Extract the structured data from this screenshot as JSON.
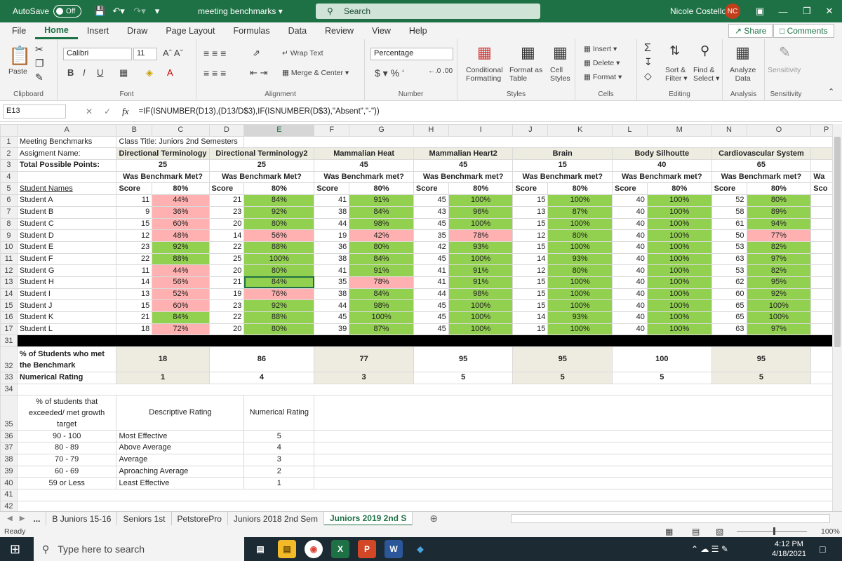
{
  "titlebar": {
    "autosave": "AutoSave",
    "toggle": "Off",
    "filename": "meeting benchmarks",
    "search": "Search",
    "user": "Nicole Costello",
    "initials": "NC"
  },
  "menu": [
    "File",
    "Home",
    "Insert",
    "Draw",
    "Page Layout",
    "Formulas",
    "Data",
    "Review",
    "View",
    "Help"
  ],
  "share": "Share",
  "comments": "Comments",
  "ribbon": {
    "paste": "Paste",
    "clipboard": "Clipboard",
    "font_name": "Calibri",
    "font_size": "11",
    "font": "Font",
    "wrap": "Wrap Text",
    "merge": "Merge & Center",
    "alignment": "Alignment",
    "numfmt": "Percentage",
    "number": "Number",
    "cond": "Conditional",
    "cond2": "Formatting",
    "fmt_table": "Format as",
    "fmt_table2": "Table",
    "cell_styles": "Cell",
    "cell_styles2": "Styles",
    "styles": "Styles",
    "insert": "Insert",
    "delete": "Delete",
    "format": "Format",
    "cells": "Cells",
    "sort": "Sort &",
    "sort2": "Filter",
    "find": "Find &",
    "find2": "Select",
    "editing": "Editing",
    "analyze": "Analyze",
    "analyze2": "Data",
    "analysis": "Analysis",
    "sens": "Sensitivity",
    "sensitivity": "Sensitivity"
  },
  "formula": {
    "cell": "E13",
    "fx": "fx",
    "text": "=IF(ISNUMBER(D13),(D13/D$3),IF(ISNUMBER(D$3),\"Absent\",\"-\"))"
  },
  "cols": [
    "A",
    "B",
    "C",
    "D",
    "E",
    "F",
    "G",
    "H",
    "I",
    "J",
    "K",
    "L",
    "M",
    "N",
    "O",
    "P"
  ],
  "rownums": [
    "1",
    "2",
    "3",
    "4",
    "5",
    "6",
    "7",
    "8",
    "9",
    "10",
    "11",
    "12",
    "13",
    "14",
    "15",
    "16",
    "17",
    "31",
    "32",
    "33",
    "34",
    "35",
    "36",
    "37",
    "38",
    "39",
    "40",
    "41",
    "42"
  ],
  "sheet": {
    "a1": "Meeting Benchmarks",
    "b1": "Class Title: Juniors 2nd Semesters",
    "a2": "Assigment Name:",
    "a3": "Total Possible Points:",
    "a5": "Student Names",
    "assignments": [
      "Directional Terminology",
      "Directional Terminology2",
      "Mammalian Heat",
      "Mammalian Heart2",
      "Brain",
      "Body Silhoutte",
      "Cardiovascular System"
    ],
    "points": [
      "25",
      "25",
      "45",
      "45",
      "15",
      "40",
      "65"
    ],
    "met": [
      "Was Benchmark Met?",
      "Was Benchmark Met?",
      "Was Benchmark met?",
      "Was Benchmark met?",
      "Was Benchmark met?",
      "Was Benchmark met?",
      "Was Benchmark met?"
    ],
    "p_partial": "Wa",
    "p_score": "Sco",
    "score": "Score",
    "pct80": "80%",
    "students": [
      {
        "name": "Student A",
        "v": [
          [
            "11",
            "44%"
          ],
          [
            "21",
            "84%"
          ],
          [
            "41",
            "91%"
          ],
          [
            "45",
            "100%"
          ],
          [
            "15",
            "100%"
          ],
          [
            "40",
            "100%"
          ],
          [
            "52",
            "80%"
          ]
        ]
      },
      {
        "name": "Student B",
        "v": [
          [
            "9",
            "36%"
          ],
          [
            "23",
            "92%"
          ],
          [
            "38",
            "84%"
          ],
          [
            "43",
            "96%"
          ],
          [
            "13",
            "87%"
          ],
          [
            "40",
            "100%"
          ],
          [
            "58",
            "89%"
          ]
        ]
      },
      {
        "name": "Student C",
        "v": [
          [
            "15",
            "60%"
          ],
          [
            "20",
            "80%"
          ],
          [
            "44",
            "98%"
          ],
          [
            "45",
            "100%"
          ],
          [
            "15",
            "100%"
          ],
          [
            "40",
            "100%"
          ],
          [
            "61",
            "94%"
          ]
        ]
      },
      {
        "name": "Student D",
        "v": [
          [
            "12",
            "48%"
          ],
          [
            "14",
            "56%"
          ],
          [
            "19",
            "42%"
          ],
          [
            "35",
            "78%"
          ],
          [
            "12",
            "80%"
          ],
          [
            "40",
            "100%"
          ],
          [
            "50",
            "77%"
          ]
        ]
      },
      {
        "name": "Student E",
        "v": [
          [
            "23",
            "92%"
          ],
          [
            "22",
            "88%"
          ],
          [
            "36",
            "80%"
          ],
          [
            "42",
            "93%"
          ],
          [
            "15",
            "100%"
          ],
          [
            "40",
            "100%"
          ],
          [
            "53",
            "82%"
          ]
        ]
      },
      {
        "name": "Student F",
        "v": [
          [
            "22",
            "88%"
          ],
          [
            "25",
            "100%"
          ],
          [
            "38",
            "84%"
          ],
          [
            "45",
            "100%"
          ],
          [
            "14",
            "93%"
          ],
          [
            "40",
            "100%"
          ],
          [
            "63",
            "97%"
          ]
        ]
      },
      {
        "name": "Student G",
        "v": [
          [
            "11",
            "44%"
          ],
          [
            "20",
            "80%"
          ],
          [
            "41",
            "91%"
          ],
          [
            "41",
            "91%"
          ],
          [
            "12",
            "80%"
          ],
          [
            "40",
            "100%"
          ],
          [
            "53",
            "82%"
          ]
        ]
      },
      {
        "name": "Student H",
        "v": [
          [
            "14",
            "56%"
          ],
          [
            "21",
            "84%"
          ],
          [
            "35",
            "78%"
          ],
          [
            "41",
            "91%"
          ],
          [
            "15",
            "100%"
          ],
          [
            "40",
            "100%"
          ],
          [
            "62",
            "95%"
          ]
        ]
      },
      {
        "name": "Student I",
        "v": [
          [
            "13",
            "52%"
          ],
          [
            "19",
            "76%"
          ],
          [
            "38",
            "84%"
          ],
          [
            "44",
            "98%"
          ],
          [
            "15",
            "100%"
          ],
          [
            "40",
            "100%"
          ],
          [
            "60",
            "92%"
          ]
        ]
      },
      {
        "name": "Student J",
        "v": [
          [
            "15",
            "60%"
          ],
          [
            "23",
            "92%"
          ],
          [
            "44",
            "98%"
          ],
          [
            "45",
            "100%"
          ],
          [
            "15",
            "100%"
          ],
          [
            "40",
            "100%"
          ],
          [
            "65",
            "100%"
          ]
        ]
      },
      {
        "name": "Student K",
        "v": [
          [
            "21",
            "84%"
          ],
          [
            "22",
            "88%"
          ],
          [
            "45",
            "100%"
          ],
          [
            "45",
            "100%"
          ],
          [
            "14",
            "93%"
          ],
          [
            "40",
            "100%"
          ],
          [
            "65",
            "100%"
          ]
        ]
      },
      {
        "name": "Student L",
        "v": [
          [
            "18",
            "72%"
          ],
          [
            "20",
            "80%"
          ],
          [
            "39",
            "87%"
          ],
          [
            "45",
            "100%"
          ],
          [
            "15",
            "100%"
          ],
          [
            "40",
            "100%"
          ],
          [
            "63",
            "97%"
          ]
        ]
      }
    ],
    "pct_label1": "% of Students who met",
    "pct_label2": "the Benchmark",
    "pct_met": [
      "18",
      "86",
      "77",
      "95",
      "95",
      "100",
      "95"
    ],
    "num_label": "Numerical Rating",
    "ratings": [
      "1",
      "4",
      "3",
      "5",
      "5",
      "5",
      "5"
    ],
    "leg_h1": "% of students that",
    "leg_h2": "exceeded/ met growth",
    "leg_h3": "target",
    "leg_desc": "Descriptive Rating",
    "leg_num": "Numerical Rating",
    "legend": [
      [
        "90 - 100",
        "Most Effective",
        "5"
      ],
      [
        "80 - 89",
        "Above Average",
        "4"
      ],
      [
        "70 - 79",
        "Average",
        "3"
      ],
      [
        "60 - 69",
        "Aproaching Average",
        "2"
      ],
      [
        "59 or Less",
        "Least Effective",
        "1"
      ]
    ]
  },
  "tabs": [
    "...",
    "B Juniors 15-16",
    "Seniors 1st",
    "PetstorePro",
    "Juniors 2018 2nd Sem",
    "Juniors 2019 2nd S"
  ],
  "status": {
    "ready": "Ready",
    "zoom": "100%"
  },
  "taskbar": {
    "search": "Type here to search",
    "time": "4:12 PM",
    "date": "4/18/2021"
  },
  "colors": {
    "green": "#92d050",
    "pink": "#ffb0b0",
    "brand": "#1e7145"
  }
}
